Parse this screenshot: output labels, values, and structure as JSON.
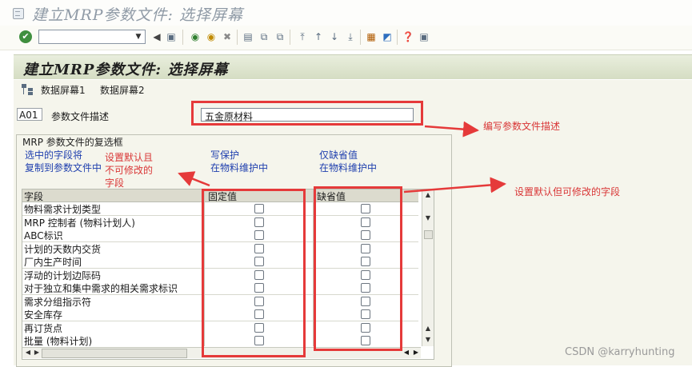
{
  "window": {
    "title": "建立MRP参数文件: 选择屏幕"
  },
  "toolbar": {
    "command_value": ""
  },
  "screen": {
    "header": "建立MRP参数文件: 选择屏幕"
  },
  "app_toolbar": {
    "buttons": [
      "数据屏幕1",
      "数据屏幕2"
    ]
  },
  "profile": {
    "code": "A01",
    "label": "参数文件描述",
    "value": "五金原材料"
  },
  "group": {
    "title": "MRP 参数文件的复选框",
    "col_intro": [
      "选中的字段将",
      "复制到参数文件中"
    ],
    "fixed_intro": [
      "写保护",
      "在物料维护中"
    ],
    "default_intro": [
      "仅缺省值",
      "在物料维护中"
    ]
  },
  "table": {
    "headers": {
      "field": "字段",
      "fixed": "固定值",
      "default": "缺省值"
    },
    "rows": [
      "物料需求计划类型",
      "MRP 控制者 (物料计划人)",
      "ABC标识",
      "计划的天数内交货",
      "厂内生产时间",
      "浮动的计划边际码",
      "对于独立和集中需求的相关需求标识",
      "需求分组指示符",
      "安全库存",
      "再订货点",
      "批量 (物料计划)"
    ]
  },
  "annotations": {
    "describe_note": "编写参数文件描述",
    "fixed_note": [
      "设置默认且",
      "不可修改的",
      "字段"
    ],
    "default_note": "设置默认但可修改的字段"
  },
  "watermark": "CSDN @karryhunting",
  "colors": {
    "annotation_red": "#e53a3a",
    "blue_text": "#1f3fae"
  }
}
